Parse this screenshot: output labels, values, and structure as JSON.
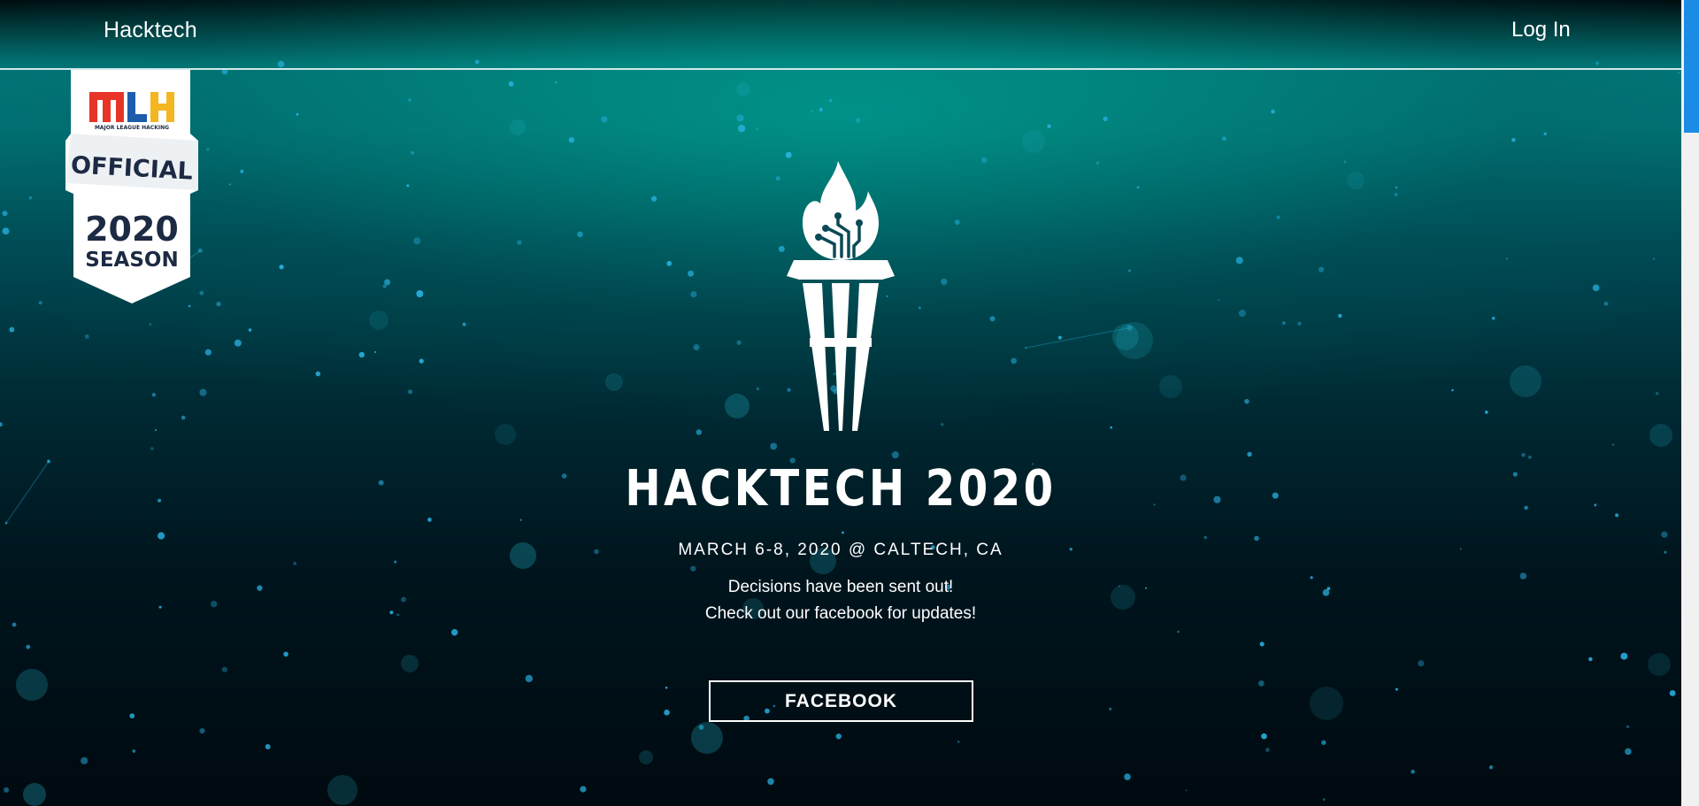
{
  "nav": {
    "brand": "Hacktech",
    "login": "Log In"
  },
  "badge": {
    "logo_text": "MLH",
    "logo_subtext": "MAJOR LEAGUE HACKING",
    "official": "OFFICIAL",
    "year": "2020",
    "season": "SEASON"
  },
  "hero": {
    "title": "HACKTECH 2020",
    "date_location": "MARCH 6-8, 2020 @ CALTECH, CA",
    "message_line1": "Decisions have been sent out!",
    "message_line2": "Check out our facebook for updates!",
    "button_label": "FACEBOOK"
  },
  "colors": {
    "accent_teal": "#02797a",
    "star_blue": "#29b6e8",
    "scrollbar_thumb": "#1a8ce6",
    "mlh_red": "#e73427",
    "mlh_blue": "#1c5cab",
    "mlh_yellow": "#f4b620",
    "badge_navy": "#1d2a44"
  }
}
